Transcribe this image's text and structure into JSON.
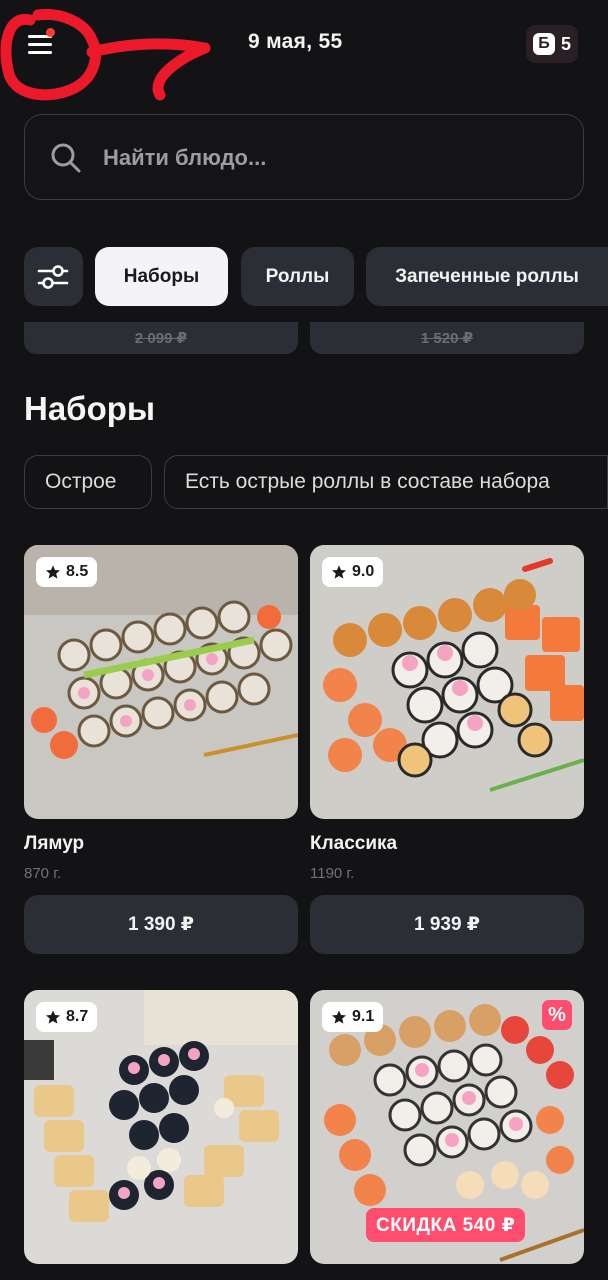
{
  "header": {
    "title": "9 мая,  55",
    "bonus_count": "5",
    "menu_icon": "hamburger-menu-icon",
    "bonus_icon": "bonus-b-icon"
  },
  "search": {
    "placeholder": "Найти блюдо..."
  },
  "categories": [
    "Наборы",
    "Роллы",
    "Запеченные роллы"
  ],
  "active_category": "Наборы",
  "previous_prices": [
    "2 099 ₽",
    "1 520 ₽"
  ],
  "section": {
    "title": "Наборы",
    "tags": [
      "Острое",
      "Есть острые роллы в составе набора"
    ]
  },
  "products": [
    {
      "name": "Лямур",
      "weight": "870 г.",
      "price": "1 390 ₽",
      "rating": "8.5"
    },
    {
      "name": "Классика",
      "weight": "1190 г.",
      "price": "1 939 ₽",
      "rating": "9.0"
    },
    {
      "rating": "8.7"
    },
    {
      "rating": "9.1",
      "discount_label": "СКИДКА 540 ₽",
      "discount_icon": "%"
    }
  ],
  "colors": {
    "background": "#131315",
    "chip": "#2b2e35",
    "accent_pink": "#ff4d6d",
    "annotation_red": "#ff1a2e"
  }
}
